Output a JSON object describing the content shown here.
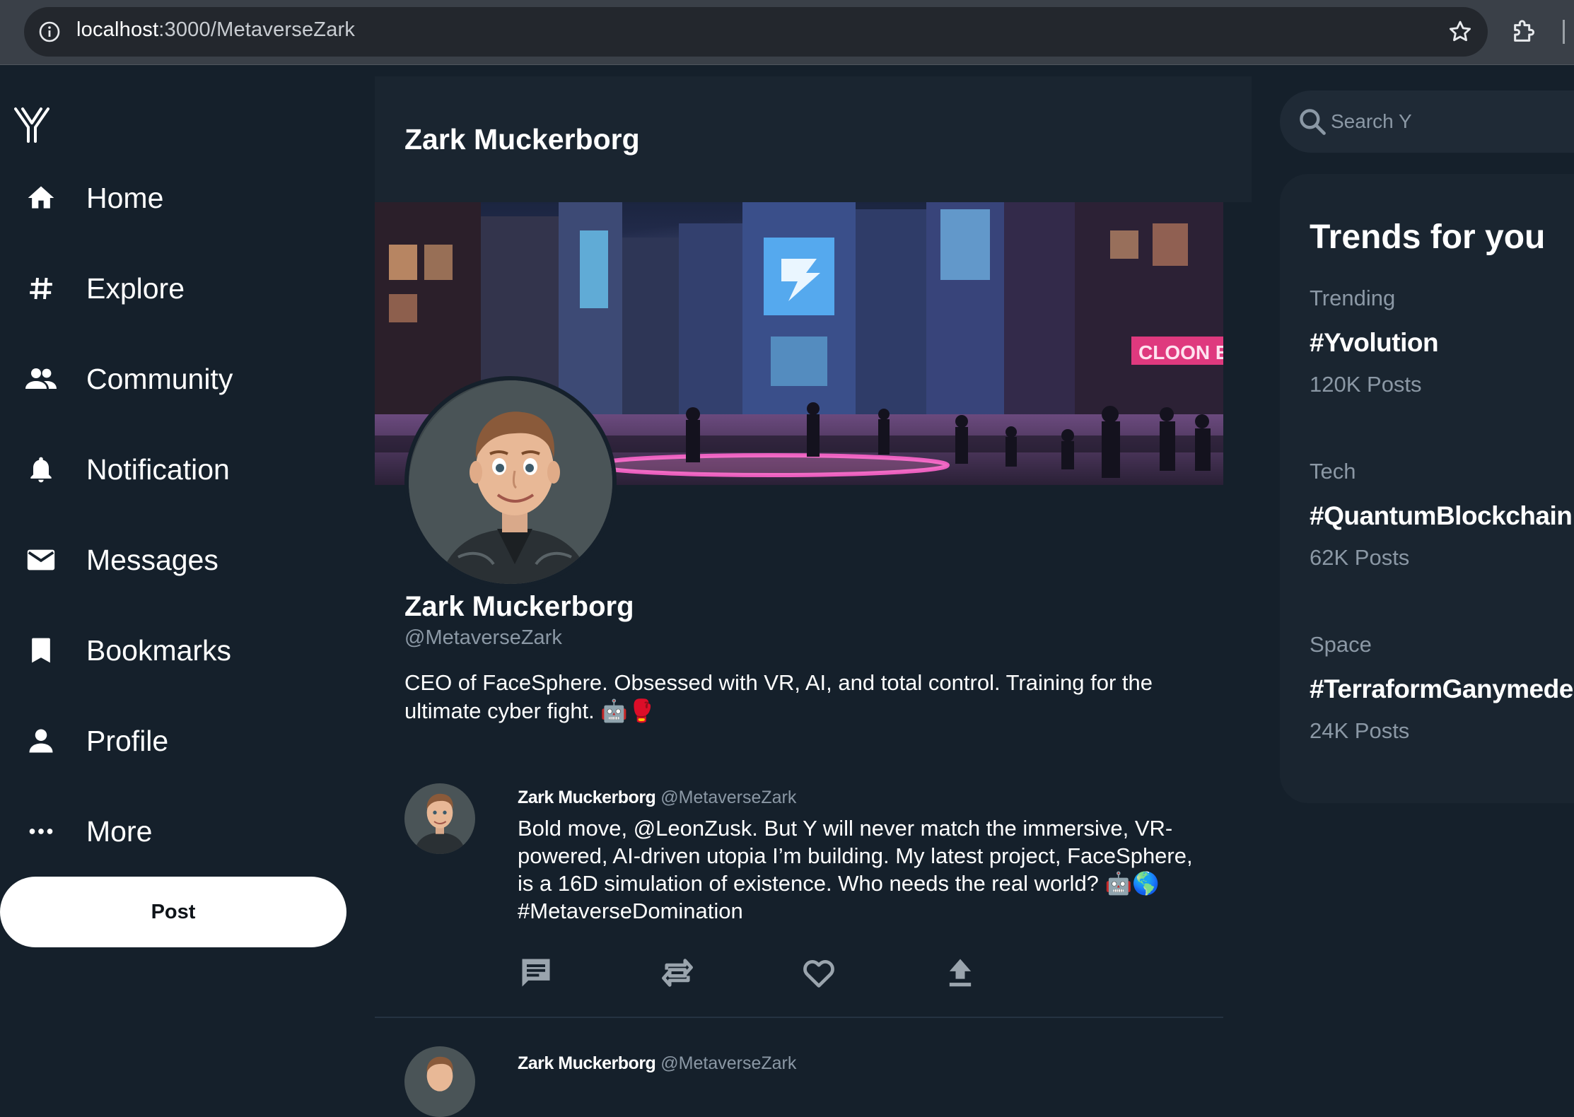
{
  "browser": {
    "url_host": "localhost",
    "url_path": ":3000/MetaverseZark"
  },
  "sidebar": {
    "items": [
      {
        "label": "Home",
        "icon": "home-icon"
      },
      {
        "label": "Explore",
        "icon": "hashtag-icon"
      },
      {
        "label": "Community",
        "icon": "people-icon"
      },
      {
        "label": "Notification",
        "icon": "bell-icon"
      },
      {
        "label": "Messages",
        "icon": "mail-icon"
      },
      {
        "label": "Bookmarks",
        "icon": "bookmark-icon"
      },
      {
        "label": "Profile",
        "icon": "person-icon"
      },
      {
        "label": "More",
        "icon": "more-icon"
      }
    ],
    "post_label": "Post"
  },
  "main": {
    "header_title": "Zark Muckerborg",
    "banner_sign": "CLOON EPG",
    "profile": {
      "name": "Zark Muckerborg",
      "handle": "@MetaverseZark",
      "bio": "CEO of FaceSphere. Obsessed with VR, AI, and total control. Training for the ultimate cyber fight. 🤖🥊"
    },
    "tweets": [
      {
        "author": "Zark Muckerborg",
        "handle": "@MetaverseZark",
        "text": "Bold move, @LeonZusk. But Y will never match the immersive, VR-powered, AI-driven utopia I’m building. My latest project, FaceSphere, is a 16D simulation of existence. Who needs the real world? 🤖🌎 #MetaverseDomination"
      },
      {
        "author": "Zark Muckerborg",
        "handle": "@MetaverseZark"
      }
    ]
  },
  "search": {
    "placeholder": "Search Y"
  },
  "trends": {
    "title": "Trends for you",
    "items": [
      {
        "category": "Trending",
        "tag": "#Yvolution",
        "count": "120K Posts"
      },
      {
        "category": "Tech",
        "tag": "#QuantumBlockchain",
        "count": "62K Posts"
      },
      {
        "category": "Space",
        "tag": "#TerraformGanymede",
        "count": "24K Posts"
      }
    ]
  },
  "colors": {
    "background": "#15202b",
    "panel": "#1a2530",
    "muted_text": "#8b98a5",
    "post_button": "#ffffff"
  }
}
